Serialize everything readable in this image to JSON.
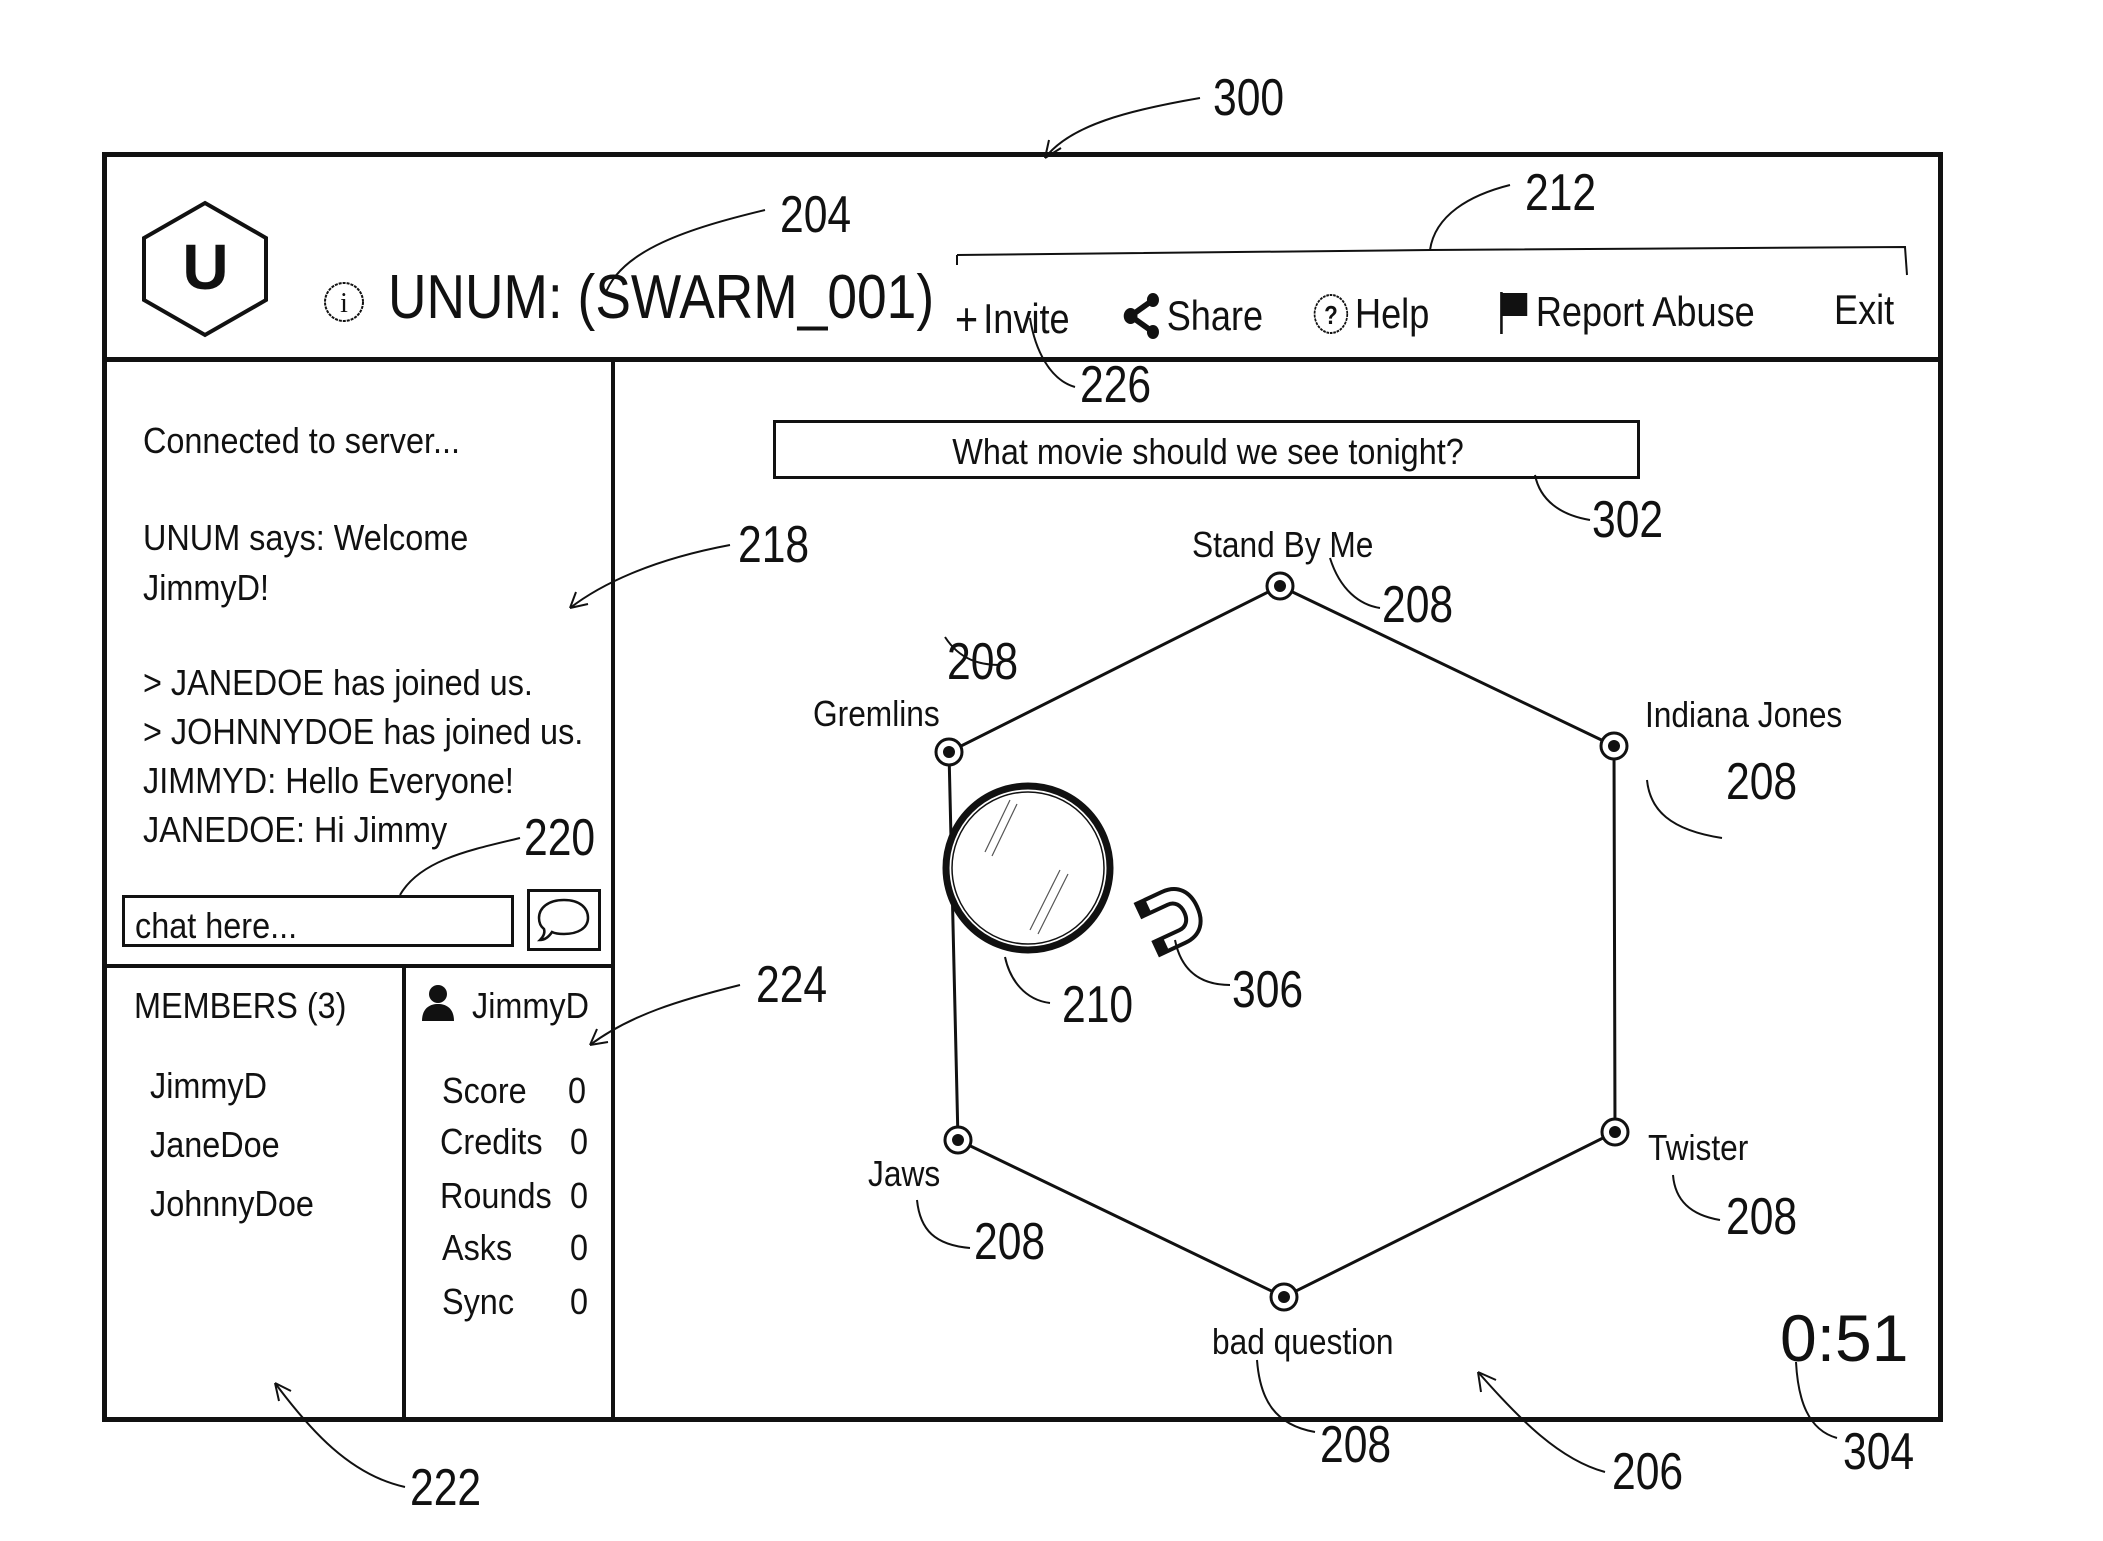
{
  "figure_number": "300",
  "header": {
    "logo_letter": "U",
    "title": "UNUM: (SWARM_001)",
    "info_icon": "info-icon",
    "toolbar": [
      {
        "id": "invite",
        "icon": "plus-icon",
        "label": "Invite"
      },
      {
        "id": "share",
        "icon": "share-icon",
        "label": "Share"
      },
      {
        "id": "help",
        "icon": "help-icon",
        "label": "Help"
      },
      {
        "id": "report",
        "icon": "flag-icon",
        "label": "Report Abuse"
      },
      {
        "id": "exit",
        "icon": "",
        "label": "Exit"
      }
    ]
  },
  "chat": {
    "messages": [
      "Connected to server...",
      "UNUM says: Welcome",
      "JimmyD!",
      "> JANEDOE has joined us.",
      "> JOHNNYDOE has joined us.",
      "JIMMYD: Hello Everyone!",
      "JANEDOE: Hi Jimmy"
    ],
    "input_placeholder": "chat here...",
    "send_icon": "speech-bubble-icon"
  },
  "members": {
    "heading": "MEMBERS (3)",
    "list": [
      "JimmyD",
      "JaneDoe",
      "JohnnyDoe"
    ]
  },
  "stats": {
    "user": "JimmyD",
    "user_icon": "user-icon",
    "rows": [
      {
        "label": "Score",
        "value": "0"
      },
      {
        "label": "Credits",
        "value": "0"
      },
      {
        "label": "Rounds",
        "value": "0"
      },
      {
        "label": "Asks",
        "value": "0"
      },
      {
        "label": "Sync",
        "value": "0"
      }
    ]
  },
  "board": {
    "question": "What movie should we see tonight?",
    "answers": [
      "Stand By Me",
      "Indiana Jones",
      "Twister",
      "bad question",
      "Jaws",
      "Gremlins"
    ],
    "timer": "0:51",
    "puck_icon": "puck-icon",
    "magnet_icon": "magnet-icon"
  },
  "reference_numerals": {
    "r300": "300",
    "r204": "204",
    "r212": "212",
    "r226": "226",
    "r302": "302",
    "r218": "218",
    "r220": "220",
    "r224": "224",
    "r222": "222",
    "r208": "208",
    "r210": "210",
    "r306": "306",
    "r206": "206",
    "r304": "304"
  }
}
